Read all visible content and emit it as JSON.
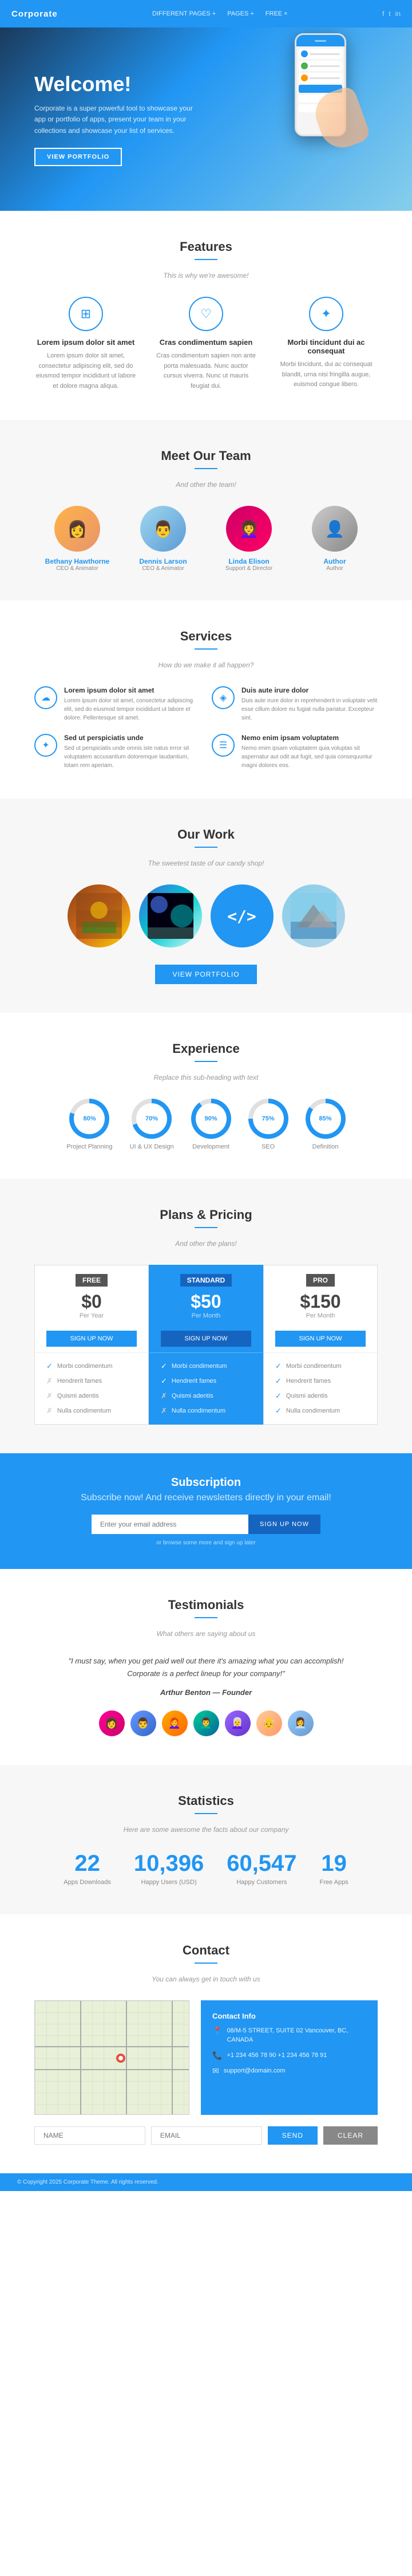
{
  "nav": {
    "logo": "Corporate",
    "links": [
      "DIFFERENT PAGES +",
      "PAGES +",
      "FREE ×"
    ],
    "social": [
      "f",
      "t",
      "in"
    ]
  },
  "hero": {
    "title": "Welcome!",
    "body": "Corporate is a super powerful tool to showcase your app or portfolio of apps, present your team in your collections and showcase your list of services.",
    "btn": "VIEW PORTFOLIO"
  },
  "features": {
    "title": "Features",
    "subtitle": "This is why we're awesome!",
    "items": [
      {
        "icon": "⊞",
        "title": "Lorem ipsum dolor sit amet",
        "body": "Lorem ipsum dolor sit amet, consectetur adipiscing elit, sed do eiusmod tempor incididunt ut labore et dolore magna aliqua."
      },
      {
        "icon": "♡",
        "title": "Cras condimentum sapien",
        "body": "Cras condimentum sapien non ante porta malesuada. Nunc auctor cursus viverra. Nunc ut mauris feugiat dui."
      },
      {
        "icon": "✦",
        "title": "Morbi tincidunt dui ac consequat",
        "body": "Morbi tincidunt, dui ac consequat blandit, urna nisi fringilla augue, euismod congue libero."
      }
    ]
  },
  "team": {
    "title": "Meet Our Team",
    "subtitle": "And other the team!",
    "members": [
      {
        "name": "Bethany Hawthorne",
        "role": "CEO & Animator",
        "emoji": "👩"
      },
      {
        "name": "Dennis Larson",
        "role": "CEO & Animator",
        "emoji": "👨"
      },
      {
        "name": "Linda Elison",
        "role": "Support & Director",
        "emoji": "👩‍🦱"
      },
      {
        "name": "Author",
        "role": "Author",
        "emoji": "👤"
      }
    ]
  },
  "services": {
    "title": "Services",
    "subtitle": "How do we make it all happen?",
    "items": [
      {
        "icon": "☁",
        "title": "Lorem ipsum dolor sit amet",
        "body": "Lorem ipsum dolor sit amet, consectetur adipiscing elit, sed do eiusmod tempor incididunt ut labore et dolore. Pellentesque sit amet."
      },
      {
        "icon": "◈",
        "title": "Duis aute irure dolor",
        "body": "Duis aute irure dolor in reprehenderit in voluptate velit esse cillum dolore eu fugiat nulla pariatur. Excepteur sint."
      },
      {
        "icon": "✦",
        "title": "Sed ut perspiciatis unde",
        "body": "Sed ut perspiciatis unde omnis iste natus error sit voluptatem accusantium doloremque laudantium, totam rem aperiam."
      },
      {
        "icon": "☰",
        "title": "Nemo enim ipsam voluptatem",
        "body": "Nemo enim ipsam voluptatem quia voluptas sit aspernatur aut odit aut fugit, sed quia consequuntur magni dolores eos."
      }
    ]
  },
  "portfolio": {
    "title": "Our Work",
    "subtitle": "The sweetest taste of our candy shop!",
    "btn": "VIEW PORTFOLIO",
    "items": [
      "🎨",
      "🌌",
      "</>",
      "🏔"
    ]
  },
  "experience": {
    "title": "Experience",
    "subtitle": "Replace this sub-heading with text",
    "items": [
      {
        "label": "Project Planning",
        "pct": "80%",
        "deg": 288
      },
      {
        "label": "UI & UX Design",
        "pct": "70%",
        "deg": 252
      },
      {
        "label": "Development",
        "pct": "90%",
        "deg": 324
      },
      {
        "label": "SEO",
        "pct": "75%",
        "deg": 270
      },
      {
        "label": "Definition",
        "pct": "85%",
        "deg": 306
      }
    ]
  },
  "pricing": {
    "title": "Plans & Pricing",
    "subtitle": "And other the plans!",
    "plans": [
      {
        "name": "FREE",
        "amount": "$0",
        "period": "Per Year",
        "btn": "SIGN UP NOW",
        "featured": false,
        "features": [
          {
            "check": true,
            "text": "Morbi condimentum"
          },
          {
            "check": false,
            "text": "Hendrerit fames"
          },
          {
            "check": false,
            "text": "Quismi adentis"
          },
          {
            "check": false,
            "text": "Nulla condimentum"
          }
        ]
      },
      {
        "name": "STANDARD",
        "amount": "$50",
        "period": "Per Month",
        "btn": "SIGN UP NOW",
        "featured": true,
        "features": [
          {
            "check": true,
            "text": "Morbi condimentum"
          },
          {
            "check": true,
            "text": "Hendrerit fames"
          },
          {
            "check": false,
            "text": "Quismi adentis"
          },
          {
            "check": false,
            "text": "Nulla condimentum"
          }
        ]
      },
      {
        "name": "PRO",
        "amount": "$150",
        "period": "Per Month",
        "btn": "SIGN UP NOW",
        "featured": false,
        "features": [
          {
            "check": true,
            "text": "Morbi condimentum"
          },
          {
            "check": true,
            "text": "Hendrerit fames"
          },
          {
            "check": true,
            "text": "Quismi adentis"
          },
          {
            "check": true,
            "text": "Nulla condimentum"
          }
        ]
      }
    ]
  },
  "subscription": {
    "title": "Subscription",
    "subtitle": "Subscribe now! And receive newsletters directly in your email!",
    "placeholder": "Enter your email address",
    "btn": "SIGN UP NOW",
    "note": "or browse some more and sign up later"
  },
  "testimonials": {
    "title": "Testimonials",
    "subtitle": "What others are saying about us",
    "quote": "\"I must say, when you get paid well out there it's amazing what you can accomplish! Corporate is a perfect lineup for your company!\"",
    "author": "Arthur Benton — Founder"
  },
  "statistics": {
    "title": "Statistics",
    "subtitle": "Here are some awesome the facts about our company",
    "items": [
      {
        "number": "22",
        "label": "Apps Downloads"
      },
      {
        "number": "10,396",
        "label": "Happy Users (USD)"
      },
      {
        "number": "60,547",
        "label": "Happy Customers"
      },
      {
        "number": "19",
        "label": "Free Apps"
      }
    ]
  },
  "contact": {
    "title": "Contact",
    "subtitle": "You can always get in touch with us",
    "address": "08/M-5 STREET, SUITE 02\nVancouver, BC, CANADA",
    "phone": "+1 234 456 78 90\n+1 234 456 78 91",
    "email": "support@domain.com",
    "input_name": "NAME",
    "input_email": "EMAIL",
    "send_btn": "SEND",
    "clear_btn": "CLEAR"
  },
  "footer": {
    "copy": "© Copyright 2025 Corporate Theme. All rights reserved."
  }
}
